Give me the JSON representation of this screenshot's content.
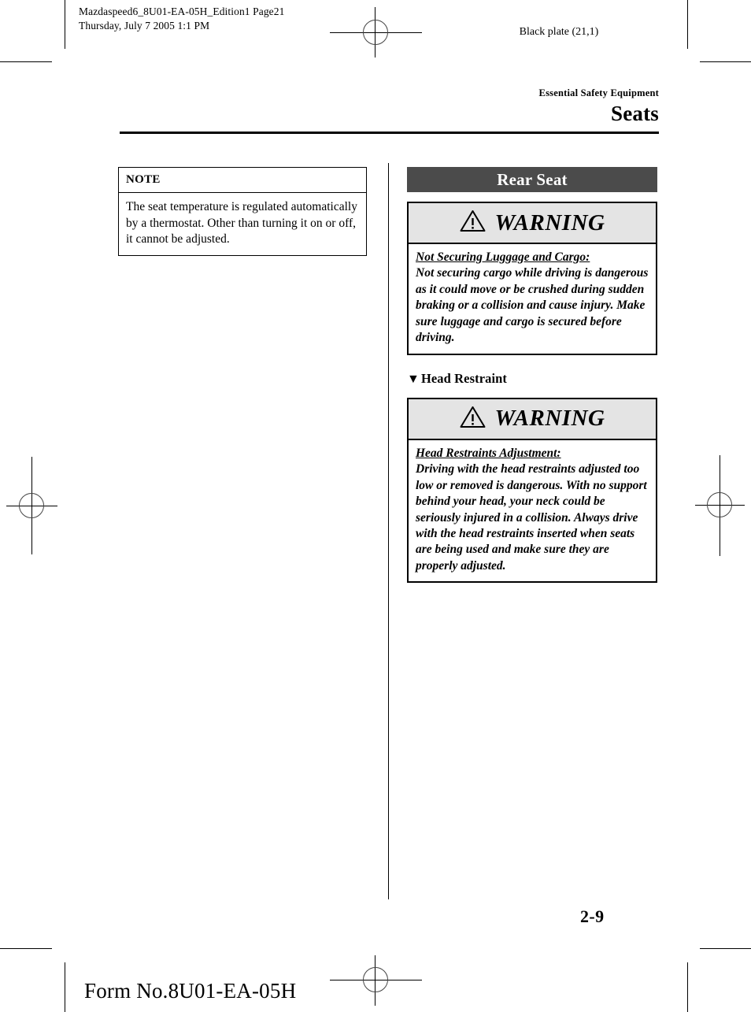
{
  "print_job": {
    "file_line": "Mazdaspeed6_8U01-EA-05H_Edition1 Page21",
    "date_line": "Thursday, July 7 2005 1:1 PM",
    "plate": "Black plate (21,1)"
  },
  "running_head": {
    "kicker": "Essential Safety Equipment",
    "title": "Seats"
  },
  "left_column": {
    "note": {
      "title": "NOTE",
      "body": "The seat temperature is regulated automatically by a thermostat. Other than turning it on or off, it cannot be adjusted."
    }
  },
  "right_column": {
    "section_band": "Rear Seat",
    "warning_label": "WARNING",
    "warning_cargo": {
      "title": "Not Securing Luggage and Cargo:",
      "text": "Not securing cargo while driving is dangerous as it could move or be crushed during sudden braking or a collision and cause injury. Make sure luggage and cargo is secured before driving."
    },
    "subhead_head_restraint": {
      "bullet": "▼",
      "label": "Head Restraint"
    },
    "warning_head_restraint": {
      "title": "Head Restraints Adjustment:",
      "text": "Driving with the head restraints adjusted too low or removed is dangerous. With no support behind your head, your neck could be seriously injured in a collision. Always drive with the head restraints inserted when seats are being used and make sure they are properly adjusted."
    }
  },
  "footer": {
    "page_number": "2-9",
    "form_number": "Form No.8U01-EA-05H"
  },
  "colors": {
    "band_background": "#4b4b4b",
    "band_text": "#ffffff",
    "warning_header_background": "#e4e4e4",
    "rule": "#000000"
  }
}
